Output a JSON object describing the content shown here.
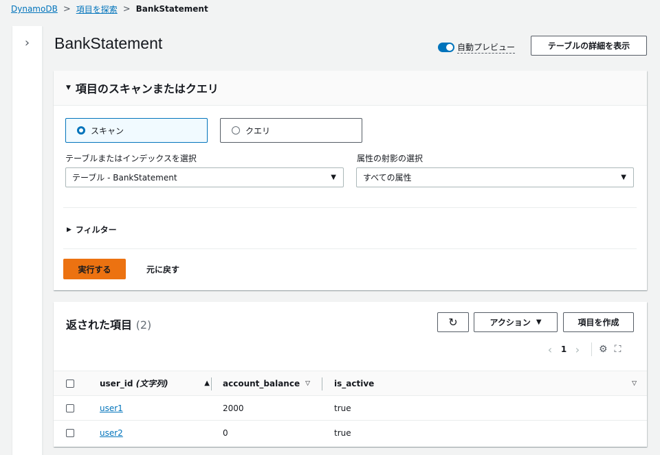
{
  "breadcrumb": {
    "root": "DynamoDB",
    "explore": "項目を探索",
    "current": "BankStatement"
  },
  "page": {
    "title": "BankStatement",
    "auto_preview_label": "自動プレビュー",
    "table_details_button": "テーブルの詳細を表示"
  },
  "scan_panel": {
    "header": "項目のスキャンまたはクエリ",
    "mode_scan": "スキャン",
    "mode_query": "クエリ",
    "selected_mode": "scan",
    "table_select_label": "テーブルまたはインデックスを選択",
    "table_select_value": "テーブル - BankStatement",
    "projection_label": "属性の射影の選択",
    "projection_value": "すべての属性",
    "filter_label": "フィルター",
    "run_button": "実行する",
    "reset_button": "元に戻す"
  },
  "results": {
    "title": "返された項目",
    "count": "(2)",
    "actions_button": "アクション",
    "create_button": "項目を作成",
    "current_page": "1",
    "columns": [
      {
        "key": "user_id",
        "label": "user_id",
        "type_hint": "(文字列)",
        "sort": "asc"
      },
      {
        "key": "account_balance",
        "label": "account_balance",
        "sort": "none"
      },
      {
        "key": "is_active",
        "label": "is_active",
        "sort": "none"
      }
    ],
    "rows": [
      {
        "user_id": "user1",
        "account_balance": "2000",
        "is_active": "true"
      },
      {
        "user_id": "user2",
        "account_balance": "0",
        "is_active": "true"
      }
    ]
  },
  "colors": {
    "accent": "#0073bb",
    "primary_button": "#ec7211",
    "background": "#f2f3f3"
  }
}
